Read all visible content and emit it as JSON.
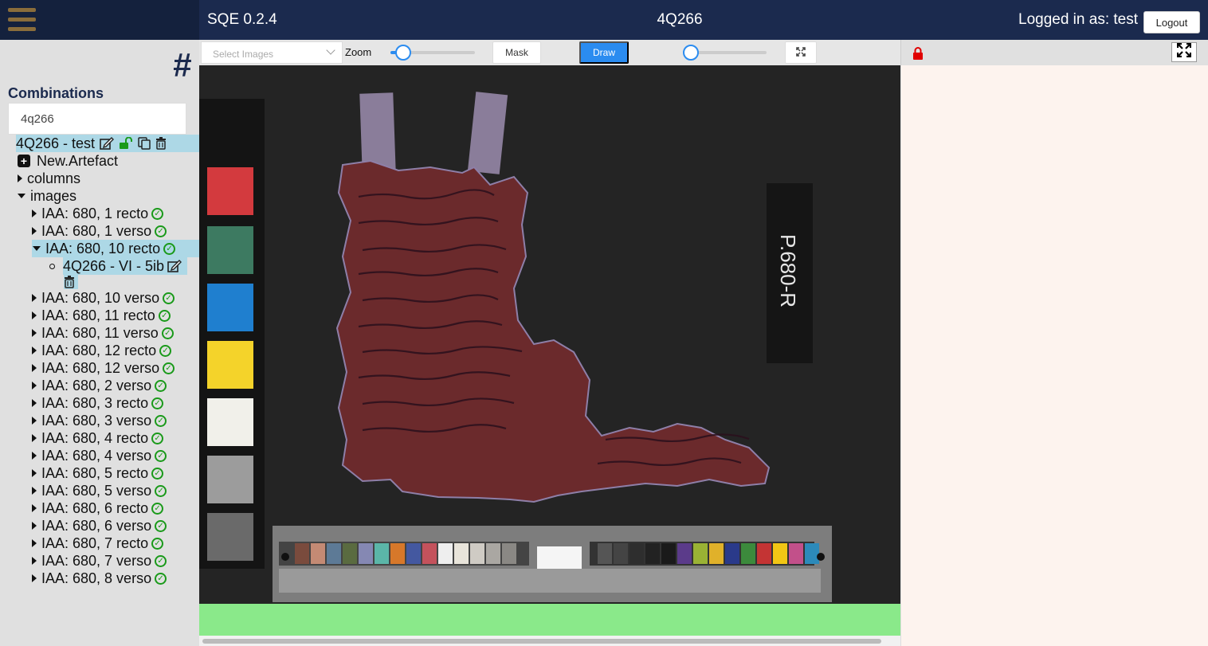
{
  "app": {
    "title": "SQE 0.2.4",
    "edition": "4Q266",
    "login_text": "Logged in as: test",
    "logout_label": "Logout"
  },
  "sidebar": {
    "combinations_label": "Combinations",
    "search_value": "4q266",
    "combination": {
      "label": "4Q266 - test"
    },
    "new_artefact_label": "New.Artefact",
    "columns_label": "columns",
    "images_label": "images",
    "images": [
      "IAA: 680, 1 recto",
      "IAA: 680, 1 verso",
      "IAA: 680, 10 recto",
      "IAA: 680, 10 verso",
      "IAA: 680, 11 recto",
      "IAA: 680, 11 verso",
      "IAA: 680, 12 recto",
      "IAA: 680, 12 verso",
      "IAA: 680, 2 verso",
      "IAA: 680, 3 recto",
      "IAA: 680, 3 verso",
      "IAA: 680, 4 recto",
      "IAA: 680, 4 verso",
      "IAA: 680, 5 recto",
      "IAA: 680, 5 verso",
      "IAA: 680, 6 recto",
      "IAA: 680, 6 verso",
      "IAA: 680, 7 recto",
      "IAA: 680, 7 verso",
      "IAA: 680, 8 verso"
    ],
    "artefact_label": "4Q266 - VI - 5ib"
  },
  "toolbar": {
    "select_images_placeholder": "Select Images",
    "zoom_label": "Zoom",
    "zoom_level": 0.15,
    "mask_label": "Mask",
    "draw_label": "Draw",
    "brush_level": 0.09
  },
  "canvas": {
    "plate_label": "P.680-R"
  },
  "colors": {
    "navbar": "#1b2a4e",
    "accent": "#2b8cf0",
    "selected": "#add8e6",
    "status_bar": "#8ae98a",
    "check": "#1a9a1a",
    "lock": "#e00000"
  }
}
